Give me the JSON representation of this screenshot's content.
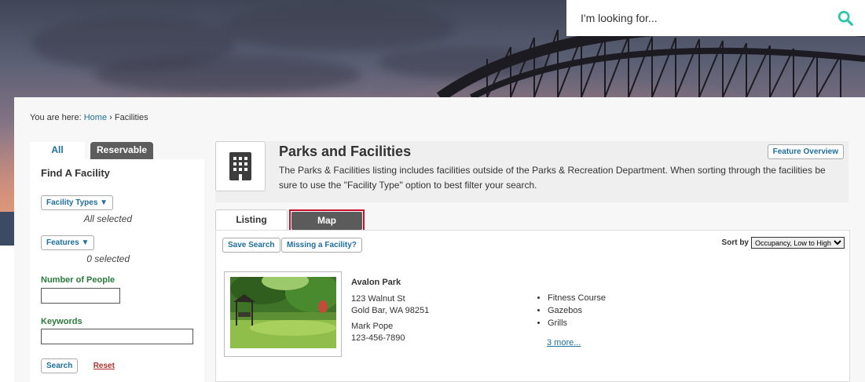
{
  "search": {
    "placeholder": "I'm looking for..."
  },
  "breadcrumb": {
    "prefix": "You are here:",
    "home": "Home",
    "separator": "›",
    "current": "Facilities"
  },
  "sidebar": {
    "tabs": [
      {
        "label": "All"
      },
      {
        "label": "Reservable"
      }
    ],
    "title": "Find A Facility",
    "facility_types": {
      "label": "Facility Types ▼",
      "status": "All selected"
    },
    "features": {
      "label": "Features ▼",
      "status": "0 selected"
    },
    "people_label": "Number of People",
    "keywords_label": "Keywords",
    "search_button": "Search",
    "reset_link": "Reset"
  },
  "header": {
    "title": "Parks and Facilities",
    "description": "The Parks & Facilities listing includes facilities outside of the Parks & Recreation Department. When sorting through the facilities be sure to use the \"Facility Type\" option to best filter your search.",
    "feature_button": "Feature Overview"
  },
  "view_tabs": {
    "listing": "Listing",
    "map": "Map"
  },
  "results": {
    "save_search": "Save Search",
    "missing_facility": "Missing a Facility?",
    "sort_label": "Sort by",
    "sort_selected": "Occupancy, Low to High"
  },
  "facility": {
    "name": "Avalon Park",
    "address1": "123 Walnut St",
    "address2": "Gold Bar, WA 98251",
    "contact": "Mark Pope",
    "phone": "123-456-7890",
    "amenities": [
      "Fitness Course",
      "Gazebos",
      "Grills"
    ],
    "more": "3 more..."
  },
  "colors": {
    "link": "#1e6f9b",
    "label_green": "#2a7a3a",
    "search_icon": "#2ec4a6",
    "highlight": "#c8102e"
  }
}
